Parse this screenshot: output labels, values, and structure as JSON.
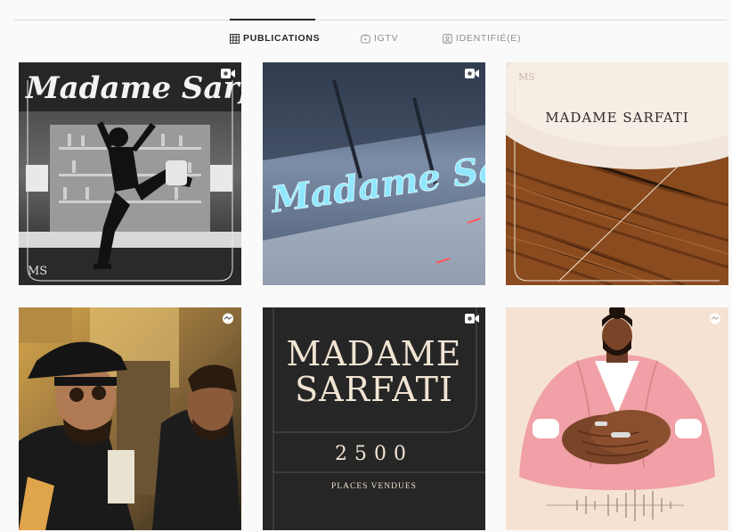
{
  "tabs": [
    {
      "label": "PUBLICATIONS",
      "icon": "grid-icon",
      "active": true
    },
    {
      "label": "IGTV",
      "icon": "igtv-icon",
      "active": false
    },
    {
      "label": "IDENTIFIÉ(E)",
      "icon": "tagged-icon",
      "active": false
    }
  ],
  "posts": [
    {
      "kind": "video",
      "overlay": "Madame Sarfati",
      "monogram": "MS"
    },
    {
      "kind": "video",
      "overlay": "Madame Sarfati"
    },
    {
      "kind": "image",
      "overlay": "MADAME SARFATI",
      "monogram": "MS"
    },
    {
      "kind": "reel"
    },
    {
      "kind": "video",
      "title": "MADAME SARFATI",
      "number": "2500",
      "caption": "PLACES VENDUES"
    },
    {
      "kind": "reel"
    }
  ],
  "colors": {
    "accent_text": "#262626",
    "muted_text": "#8e8e8e",
    "divider": "#dbdbdb",
    "cream": "#f1e4d3"
  }
}
